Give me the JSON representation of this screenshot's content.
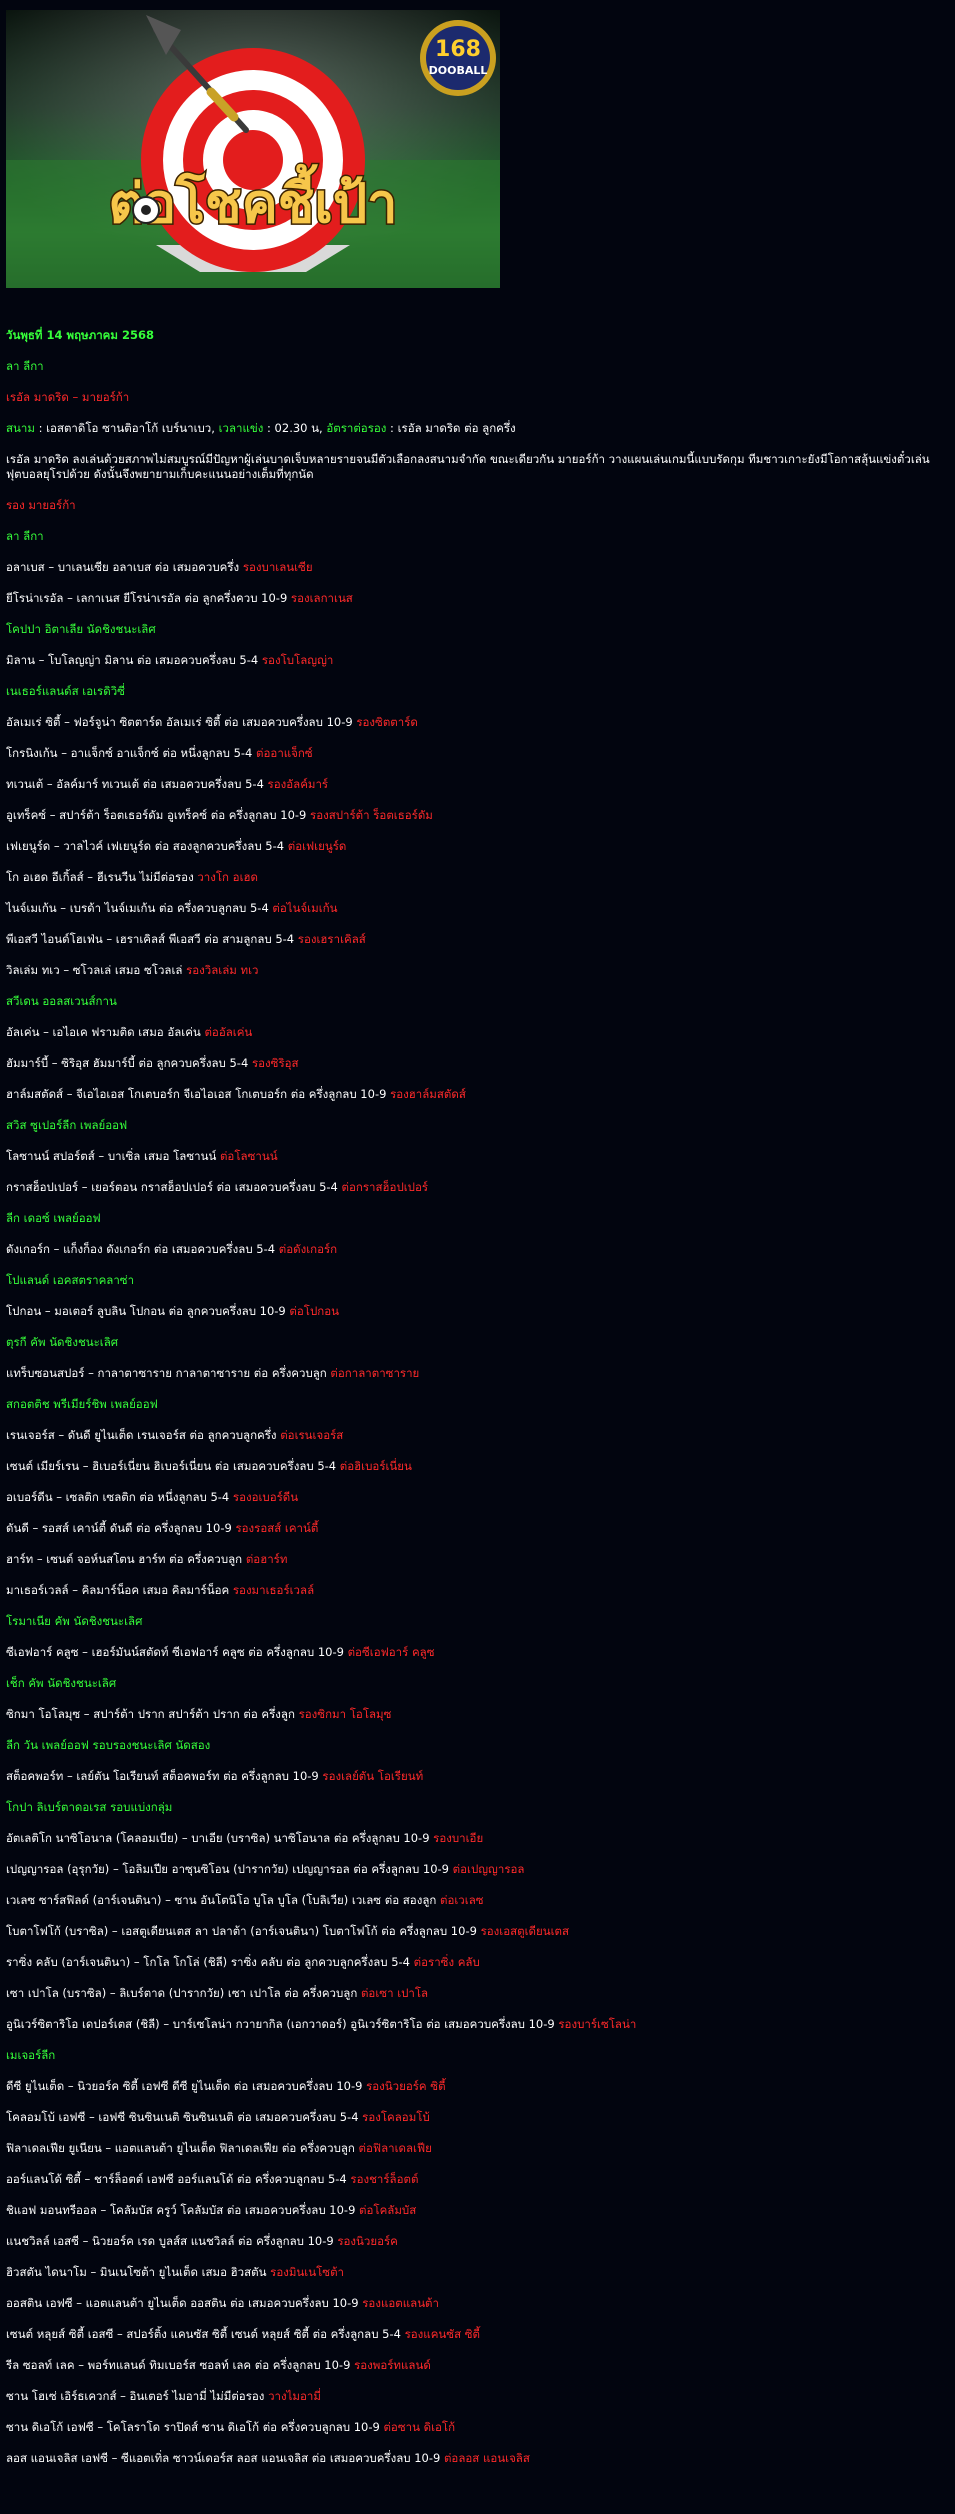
{
  "banner": {
    "title": "ต่อโชคชี้เป้า",
    "logo_top": "168",
    "logo_bottom": "DOOBALL"
  },
  "date": "วันพุธที่ 14 พฤษภาคม 2568",
  "featured": {
    "league": "ลา ลีกา",
    "match": "เรอัล มาดริด – มายอร์ก้า",
    "stadium_label": "สนาม",
    "stadium": " : เอสตาดิโอ ซานติอาโก้ เบร์นาเบว, ",
    "time_label": "เวลาแข่ง",
    "time": " : 02.30 น, ",
    "odds_label": "อัตราต่อรอง",
    "odds": " : เรอัล มาดริด ต่อ ลูกครึ่ง",
    "analysis": "เรอัล มาดริด ลงเล่นด้วยสภาพไม่สมบูรณ์มีปัญหาผู้เล่นบาดเจ็บหลายรายจนมีตัวเลือกลงสนามจำกัด ขณะเดียวกัน มายอร์ก้า วางแผนเล่นเกมนี้แบบรัดกุม ทีมชาวเกาะยังมีโอกาสลุ้นแข่งตั๋วเล่นฟุตบอลยุโรปด้วย ดังนั้นจึงพยายามเก็บคะแนนอย่างเต็มที่ทุกนัด",
    "pick": "รอง มายอร์ก้า"
  },
  "sections": [
    {
      "league": "ลา ลีกา",
      "rows": [
        {
          "text": "อลาเบส – บาเลนเซีย อลาเบส ต่อ เสมอควบครึ่ง ",
          "pick": "รองบาเลนเซีย"
        },
        {
          "text": "ยีโรน่าเรอัล – เลกาเนส ยีโรน่าเรอัล ต่อ ลูกครึ่งควบ 10-9 ",
          "pick": "รองเลกาเนส"
        }
      ]
    },
    {
      "league": "โคปปา อิตาเลีย นัดชิงชนะเลิศ",
      "rows": [
        {
          "text": "มิลาน – โบโลญญ่า มิลาน ต่อ เสมอควบครึ่งลบ 5-4 ",
          "pick": "รองโบโลญญ่า"
        }
      ]
    },
    {
      "league": "เนเธอร์แลนด์ส เอเรดิวิซี่",
      "rows": [
        {
          "text": "อัลเมเร่ ซิตี้ – ฟอร์จูน่า ซิตตาร์ด อัลเมเร่ ซิตี้ ต่อ เสมอควบครึ่งลบ 10-9 ",
          "pick": "รองซิตตาร์ด"
        },
        {
          "text": "โกรนิงเก้น – อาแจ็กซ์ อาแจ็กซ์ ต่อ หนึ่งลูกลบ 5-4 ",
          "pick": "ต่ออาแจ็กซ์"
        },
        {
          "text": "ทเวนเต้ – อัลค์มาร์ ทเวนเต้ ต่อ เสมอควบครึ่งลบ 5-4 ",
          "pick": "รองอัลค์มาร์"
        },
        {
          "text": "อูเทร็คซ์ – สปาร์ต้า ร็อตเธอร์ดัม อูเทร็คซ์ ต่อ ครึ่งลูกลบ 10-9 ",
          "pick": "รองสปาร์ต้า ร็อตเธอร์ดัม"
        },
        {
          "text": "เฟเยนูร์ด – วาลไวค์ เฟเยนูร์ด ต่อ สองลูกควบครึ่งลบ 5-4 ",
          "pick": "ต่อเฟเยนูร์ด"
        },
        {
          "text": "โก อเฮด อีเกิ้ลส์ – ฮีเรนวีน ไม่มีต่อรอง ",
          "pick": "วางโก อเฮด"
        },
        {
          "text": "ไนจ์เมเก้น – เบรด้า ไนจ์เมเก้น ต่อ ครึ่งควบลูกลบ 5-4 ",
          "pick": "ต่อไนจ์เมเก้น"
        },
        {
          "text": "พีเอสวี ไอนด์โฮเฟ่น – เฮราเคิลส์ พีเอสวี ต่อ สามลูกลบ 5-4 ",
          "pick": "รองเฮราเคิลส์"
        },
        {
          "text": "วิลเล่ม ทเว – ซโวลเล่ เสมอ ซโวลเล่ ",
          "pick": "รองวิลเล่ม ทเว"
        }
      ]
    },
    {
      "league": "สวีเดน ออลสเวนส์กาน",
      "rows": [
        {
          "text": "อัลเค่น – เอไอเค ฟรามติด เสมอ อัลเค่น ",
          "pick": "ต่ออัลเค่น"
        },
        {
          "text": "ฮัมมาร์บี้ – ซิริอุส ฮัมมาร์บี้ ต่อ ลูกควบครึ่งลบ 5-4 ",
          "pick": "รองซิริอุส"
        },
        {
          "text": "ฮาล์มสตัดส์ – จีเอไอเอส โกเตบอร์ก จีเอไอเอส โกเตบอร์ก ต่อ ครึ่งลูกลบ 10-9 ",
          "pick": "รองฮาล์มสตัดส์"
        }
      ]
    },
    {
      "league": "สวิส ซูเปอร์ลีก เพลย์ออฟ",
      "rows": [
        {
          "text": "โลซานน์ สปอร์ตส์ – บาเซิ่ล เสมอ โลซานน์ ",
          "pick": "ต่อโลซานน์"
        },
        {
          "text": "กราสฮ็อปเปอร์ – เยอร์ตอน กราสฮ็อปเปอร์ ต่อ เสมอควบครึ่งลบ 5-4 ",
          "pick": "ต่อกราสฮ็อปเปอร์"
        }
      ]
    },
    {
      "league": "ลีก เดอซ์ เพลย์ออฟ",
      "rows": [
        {
          "text": "ดังเกอร์ก – แก็งก็อง ดังเกอร์ก ต่อ เสมอควบครึ่งลบ 5-4 ",
          "pick": "ต่อดังเกอร์ก"
        }
      ]
    },
    {
      "league": "โปแลนด์ เอคสตราคลาซ่า",
      "rows": [
        {
          "text": "โปกอน – มอเตอร์ ลูบลิน โปกอน ต่อ ลูกควบครึ่งลบ 10-9 ",
          "pick": "ต่อโปกอน"
        }
      ]
    },
    {
      "league": "ตุรกี คัพ นัดชิงชนะเลิศ",
      "rows": [
        {
          "text": "แทร็บซอนสปอร์ – กาลาตาซาราย กาลาตาซาราย ต่อ ครึ่งควบลูก ",
          "pick": "ต่อกาลาตาซาราย"
        }
      ]
    },
    {
      "league": "สกอตติช พรีเมียร์ชิพ เพลย์ออฟ",
      "rows": [
        {
          "text": "เรนเจอร์ส – ดันดี ยูไนเต็ด เรนเจอร์ส ต่อ ลูกควบลูกครึ่ง ",
          "pick": "ต่อเรนเจอร์ส"
        },
        {
          "text": "เซนต์ เมียร์เรน – ฮิเบอร์เนี่ยน ฮิเบอร์เนี่ยน ต่อ เสมอควบครึ่งลบ 5-4 ",
          "pick": "ต่อฮิเบอร์เนี่ยน"
        },
        {
          "text": "อเบอร์ดีน – เซลติก เซลติก ต่อ หนึ่งลูกลบ 5-4 ",
          "pick": "รองอเบอร์ดีน"
        },
        {
          "text": "ดันดี – รอสส์ เคาน์ตี้ ดันดี ต่อ ครึ่งลูกลบ 10-9 ",
          "pick": "รองรอสส์ เคาน์ตี้"
        },
        {
          "text": "ฮาร์ท – เซนต์ จอห์นสโตน ฮาร์ท ต่อ ครึ่งควบลูก ",
          "pick": "ต่อฮาร์ท"
        },
        {
          "text": "มาเธอร์เวลล์ – คิลมาร์น็อค เสมอ คิลมาร์น็อค ",
          "pick": "รองมาเธอร์เวลล์"
        }
      ]
    },
    {
      "league": "โรมาเนีย คัพ นัดชิงชนะเลิศ",
      "rows": [
        {
          "text": "ซีเอฟอาร์ คลูซ – เฮอร์มันน์สตัดท์ ซีเอฟอาร์ คลูซ ต่อ ครึ่งลูกลบ 10-9 ",
          "pick": "ต่อซีเอฟอาร์ คลูซ"
        }
      ]
    },
    {
      "league": "เช็ก คัพ นัดชิงชนะเลิศ",
      "rows": [
        {
          "text": "ซิกมา โอโลมุซ – สปาร์ต้า ปราก สปาร์ต้า ปราก ต่อ ครึ่งลูก ",
          "pick": "รองซิกมา โอโลมุซ"
        }
      ]
    },
    {
      "league": "ลีก วัน เพลย์ออฟ รอบรองชนะเลิศ นัดสอง",
      "rows": [
        {
          "text": "สต็อคพอร์ท – เลย์ตัน โอเรียนท์ สต็อคพอร์ท ต่อ ครึ่งลูกลบ 10-9 ",
          "pick": "รองเลย์ตัน โอเรียนท์"
        }
      ]
    },
    {
      "league": "โกปา ลิเบร์ตาดอเรส รอบแบ่งกลุ่ม",
      "rows": [
        {
          "text": "อัตเลติโก นาซิโอนาล (โคลอมเบีย) – บาเอีย (บราซิล) นาซิโอนาล ต่อ ครึ่งลูกลบ 10-9 ",
          "pick": "รองบาเอีย"
        },
        {
          "text": "เปญญารอล (อุรุกวัย) – โอลิมเปีย อาซุนซิโอน (ปารากวัย) เปญญารอล ต่อ ครึ่งลูกลบ 10-9 ",
          "pick": "ต่อเปญญารอล"
        },
        {
          "text": "เวเลซ ซาร์สฟิลด์ (อาร์เจนตินา) – ซาน อันโตนิโอ บูโล บูโล (โบลิเวีย) เวเลซ ต่อ สองลูก ",
          "pick": "ต่อเวเลซ"
        },
        {
          "text": "โบตาโฟโก้ (บราซิล) – เอสตูเดียนเตส ลา ปลาต้า (อาร์เจนตินา) โบตาโฟโก้ ต่อ ครึ่งลูกลบ 10-9 ",
          "pick": "รองเอสตูเดียนเตส"
        },
        {
          "text": "ราซิ่ง คลับ (อาร์เจนตินา) – โกโล โกโล่ (ชิลี) ราซิ่ง คลับ ต่อ ลูกควบลูกครึ่งลบ 5-4 ",
          "pick": "ต่อราซิ่ง คลับ"
        },
        {
          "text": "เซา เปาโล (บราซิล) – ลิเบร์ตาด (ปารากวัย) เซา เปาโล ต่อ ครึ่งควบลูก ",
          "pick": "ต่อเซา เปาโล"
        },
        {
          "text": "อูนิเวร์ซิตาริโอ เดปอร์เตส (ชิลี) – บาร์เซโลน่า กวายากิล (เอกวาดอร์) อูนิเวร์ซิตาริโอ ต่อ เสมอควบครึ่งลบ 10-9 ",
          "pick": "รองบาร์เซโลน่า"
        }
      ]
    },
    {
      "league": "เมเจอร์ลีก",
      "rows": [
        {
          "text": "ดีซี ยูไนเต็ด – นิวยอร์ค ซิตี้ เอฟซี ดีซี ยูไนเต็ด ต่อ เสมอควบครึ่งลบ 10-9 ",
          "pick": "รองนิวยอร์ค ซิตี้"
        },
        {
          "text": "โคลอมโบ้ เอฟซี – เอฟซี ซินซินเนติ ซินซินเนติ ต่อ เสมอควบครึ่งลบ 5-4 ",
          "pick": "รองโคลอมโบ้"
        },
        {
          "text": "ฟิลาเดลเฟีย ยูเนียน – แอตแลนต้า ยูไนเต็ด ฟิลาเดลเฟีย ต่อ ครึ่งควบลูก ",
          "pick": "ต่อฟิลาเดลเฟีย"
        },
        {
          "text": "ออร์แลนโด้ ซิตี้ – ชาร์ล็อตต์ เอฟซี ออร์แลนโด้ ต่อ ครึ่งควบลูกลบ 5-4 ",
          "pick": "รองชาร์ล็อตต์"
        },
        {
          "text": "ชิแอฟ มอนทรีออล – โคลัมบัส ครูว์ โคลัมบัส ต่อ เสมอควบครึ่งลบ 10-9 ",
          "pick": "ต่อโคลัมบัส"
        },
        {
          "text": "แนชวิลล์ เอสซี – นิวยอร์ค เรด บูลส์ส แนชวิลล์ ต่อ ครึ่งลูกลบ 10-9 ",
          "pick": "รองนิวยอร์ค"
        },
        {
          "text": "ฮิวสตัน ไดนาโม – มินเนโซต้า ยูไนเต็ด เสมอ ฮิวสตัน ",
          "pick": "รองมินเนโซต้า"
        },
        {
          "text": "ออสติน เอฟซี – แอตแลนต้า ยูไนเต็ด ออสติน ต่อ เสมอควบครึ่งลบ 10-9 ",
          "pick": "รองแอตแลนต้า"
        },
        {
          "text": "เซนต์ หลุยส์ ซิตี้ เอสซี – สปอร์ติ้ง แคนซัส ซิตี้ เซนต์ หลุยส์ ซิตี้ ต่อ ครึ่งลูกลบ 5-4 ",
          "pick": "รองแคนซัส ซิตี้"
        },
        {
          "text": "รีล ซอลท์ เลค – พอร์ทแลนด์ ทิมเบอร์ส ซอลท์ เลค ต่อ ครึ่งลูกลบ 10-9 ",
          "pick": "รองพอร์ทแลนด์"
        },
        {
          "text": "ซาน โฮเซ่ เอิร์ธเควกส์ – อินเตอร์ ไมอามี่ ไม่มีต่อรอง ",
          "pick": "วางไมอามี่"
        },
        {
          "text": "ซาน ดิเอโก้ เอฟซี – โคโลราโด ราปิดส์ ซาน ดิเอโก้ ต่อ ครึ่งควบลูกลบ 10-9 ",
          "pick": "ต่อซาน ดิเอโก้"
        },
        {
          "text": "ลอส แอนเจลิส เอฟซี – ซีแอตเทิ่ล ซาวน์เดอร์ส ลอส แอนเจลิส ต่อ เสมอควบครึ่งลบ 10-9 ",
          "pick": "ต่อลอส แอนเจลิส"
        }
      ]
    }
  ]
}
